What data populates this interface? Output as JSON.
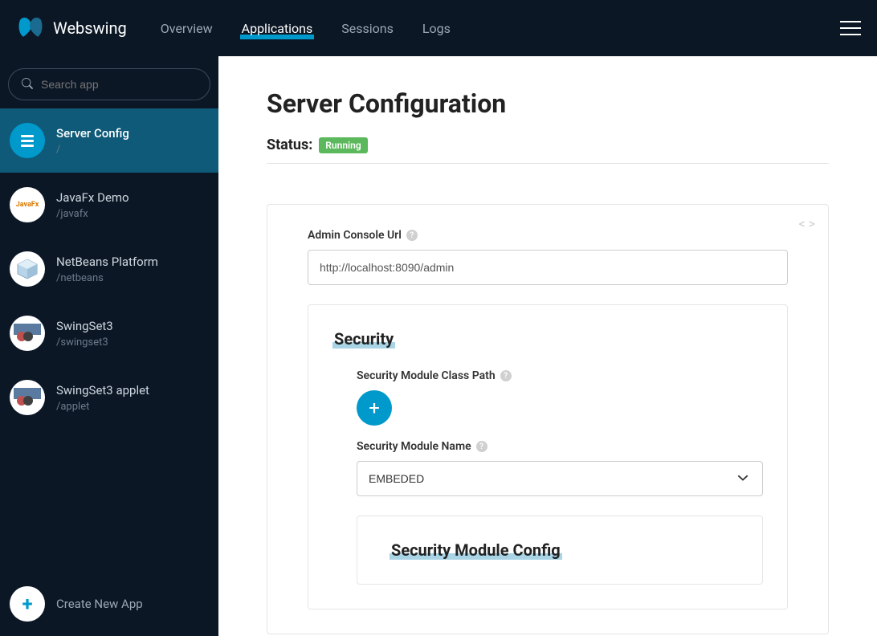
{
  "brand": "Webswing",
  "nav": {
    "overview": "Overview",
    "applications": "Applications",
    "sessions": "Sessions",
    "logs": "Logs"
  },
  "search": {
    "placeholder": "Search app"
  },
  "apps": [
    {
      "name": "Server Config",
      "path": "/"
    },
    {
      "name": "JavaFx Demo",
      "path": "/javafx"
    },
    {
      "name": "NetBeans Platform",
      "path": "/netbeans"
    },
    {
      "name": "SwingSet3",
      "path": "/swingset3"
    },
    {
      "name": "SwingSet3 applet",
      "path": "/applet"
    }
  ],
  "create_new": "Create New App",
  "page": {
    "title": "Server Configuration",
    "status_label": "Status:",
    "status_value": "Running"
  },
  "config": {
    "admin_url_label": "Admin Console Url",
    "admin_url_value": "http://localhost:8090/admin",
    "security_title": "Security",
    "sec_classpath_label": "Security Module Class Path",
    "sec_module_name_label": "Security Module Name",
    "sec_module_name_value": "EMBEDED",
    "sec_module_config_title": "Security Module Config"
  }
}
